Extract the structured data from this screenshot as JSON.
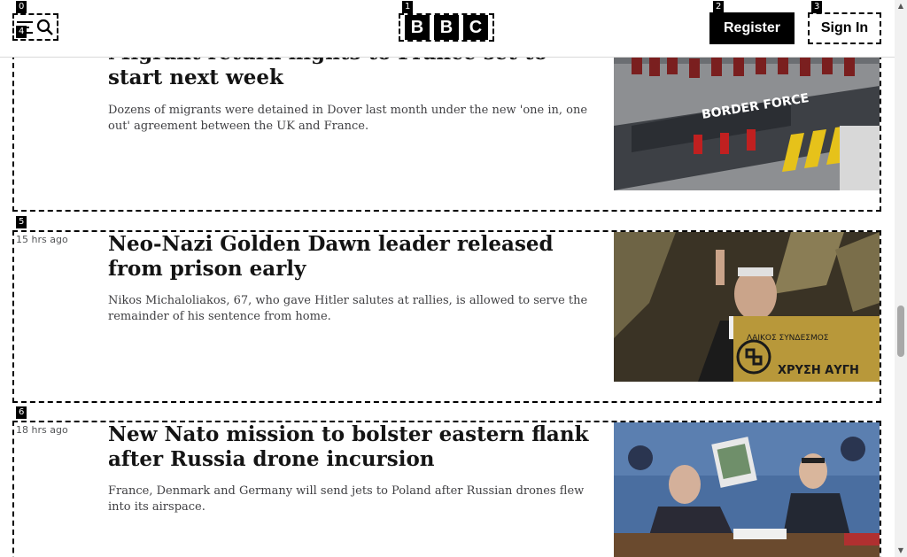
{
  "header": {
    "logo_letters": [
      "B",
      "B",
      "C"
    ],
    "register_label": "Register",
    "signin_label": "Sign In"
  },
  "tags": [
    "0",
    "1",
    "2",
    "3",
    "4",
    "5",
    "6"
  ],
  "articles": [
    {
      "timestamp": "",
      "headline": "Migrant return flights to France set to start next week",
      "summary": "Dozens of migrants were detained in Dover last month under the new 'one in, one out' agreement between the UK and France.",
      "image_text": "BORDER FORCE"
    },
    {
      "timestamp": "15 hrs ago",
      "headline": "Neo-Nazi Golden Dawn leader released from prison early",
      "summary": "Nikos Michaloliakos, 67, who gave Hitler salutes at rallies, is allowed to serve the remainder of his sentence from home.",
      "image_text": "ΛΑΙΚΟΣ ΣΥΝΔΕΣΜΟΣ",
      "image_text_2": "ΧΡΥΣΗ ΑΥΓΗ"
    },
    {
      "timestamp": "18 hrs ago",
      "headline": "New Nato mission to bolster eastern flank after Russia drone incursion",
      "summary": "France, Denmark and Germany will send jets to Poland after Russian drones flew into its airspace.",
      "image_text": ""
    }
  ],
  "colors": {
    "brand_black": "#000000",
    "text": "#141414",
    "summary_text": "#3f3f42",
    "timestamp": "#545658"
  },
  "icons": [
    "menu-icon",
    "search-icon",
    "scroll-up-arrow-icon",
    "scroll-down-arrow-icon"
  ]
}
